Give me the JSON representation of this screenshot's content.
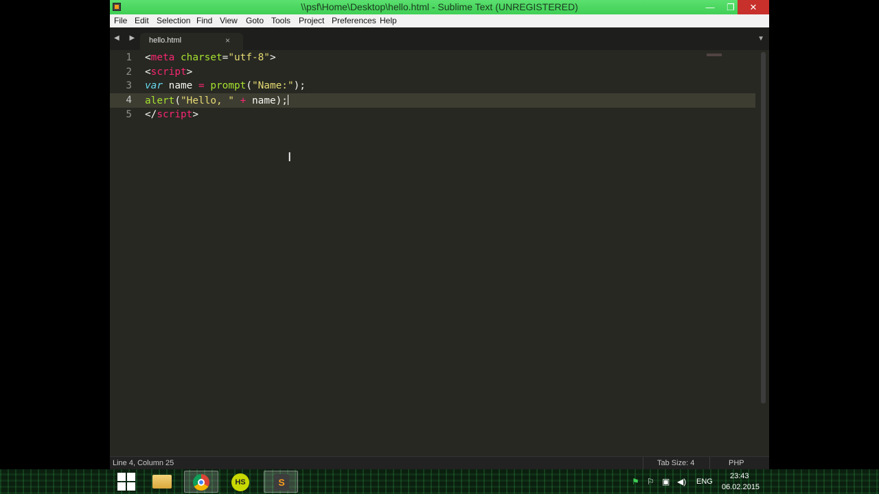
{
  "window": {
    "title": "\\\\psf\\Home\\Desktop\\hello.html - Sublime Text (UNREGISTERED)",
    "buttons": {
      "minimize": "—",
      "maximize": "❐",
      "close": "✕"
    }
  },
  "menu": [
    {
      "label": "File"
    },
    {
      "label": "Edit"
    },
    {
      "label": "Selection"
    },
    {
      "label": "Find"
    },
    {
      "label": "View"
    },
    {
      "label": "Goto"
    },
    {
      "label": "Tools"
    },
    {
      "label": "Project"
    },
    {
      "label": "Preferences"
    },
    {
      "label": "Help"
    }
  ],
  "tabs": {
    "nav": "◀ ▶",
    "active": {
      "label": "hello.html",
      "close": "×"
    },
    "menu_arrow": "▼"
  },
  "editor": {
    "active_line": 4,
    "lines": [
      {
        "num": "1",
        "tokens": [
          {
            "t": "<",
            "c": "punc"
          },
          {
            "t": "meta",
            "c": "tag"
          },
          {
            "t": " ",
            "c": "punc"
          },
          {
            "t": "charset",
            "c": "attr"
          },
          {
            "t": "=",
            "c": "punc"
          },
          {
            "t": "\"utf-8\"",
            "c": "str"
          },
          {
            "t": ">",
            "c": "punc"
          }
        ]
      },
      {
        "num": "2",
        "tokens": [
          {
            "t": "<",
            "c": "punc"
          },
          {
            "t": "script",
            "c": "tag"
          },
          {
            "t": ">",
            "c": "punc"
          }
        ]
      },
      {
        "num": "3",
        "tokens": [
          {
            "t": "var",
            "c": "kw"
          },
          {
            "t": " name ",
            "c": "punc"
          },
          {
            "t": "=",
            "c": "op"
          },
          {
            "t": " ",
            "c": "punc"
          },
          {
            "t": "prompt",
            "c": "fn"
          },
          {
            "t": "(",
            "c": "punc"
          },
          {
            "t": "\"Name:\"",
            "c": "str"
          },
          {
            "t": ");",
            "c": "punc"
          }
        ]
      },
      {
        "num": "4",
        "tokens": [
          {
            "t": "alert",
            "c": "fn"
          },
          {
            "t": "(",
            "c": "punc"
          },
          {
            "t": "\"Hello, \"",
            "c": "str"
          },
          {
            "t": " ",
            "c": "punc"
          },
          {
            "t": "+",
            "c": "op"
          },
          {
            "t": " name);",
            "c": "punc"
          }
        ]
      },
      {
        "num": "5",
        "tokens": [
          {
            "t": "</",
            "c": "punc"
          },
          {
            "t": "script",
            "c": "tag"
          },
          {
            "t": ">",
            "c": "punc"
          }
        ]
      }
    ],
    "mouse_cursor": "I"
  },
  "status": {
    "position": "Line 4, Column 25",
    "tab_size": "Tab Size: 4",
    "syntax": "PHP"
  },
  "taskbar": {
    "apps": [
      {
        "name": "file-explorer",
        "label": ""
      },
      {
        "name": "chrome",
        "label": ""
      },
      {
        "name": "hs",
        "label": "HS"
      },
      {
        "name": "sublime-text",
        "label": "S",
        "active": true
      }
    ],
    "tray": {
      "language": "ENG",
      "time": "23:43",
      "date": "06.02.2015"
    }
  }
}
